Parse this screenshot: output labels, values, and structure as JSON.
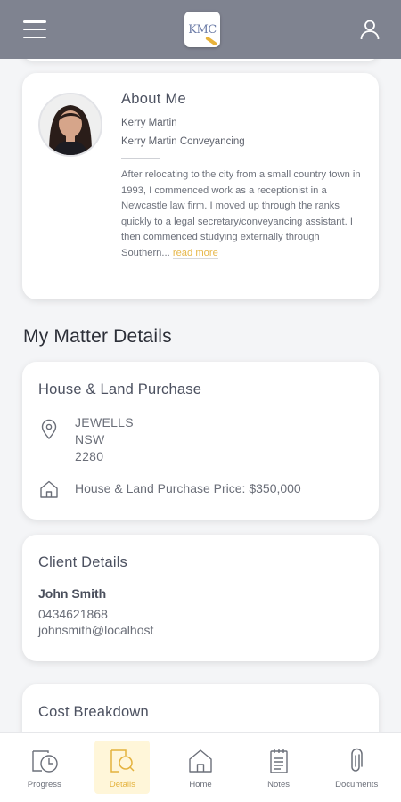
{
  "header": {
    "logo_text": "KMC",
    "menu_icon": "hamburger-menu-icon",
    "user_icon": "user-profile-icon"
  },
  "about": {
    "title": "About Me",
    "name": "Kerry Martin",
    "company": "Kerry Martin Conveyancing",
    "bio": "After relocating to the city from a small country town in 1993, I commenced work as a receptionist in a Newcastle law firm. I moved up through the ranks quickly to a legal secretary/conveyancing assistant. I then commenced studying externally through Southern...",
    "read_more": "read more"
  },
  "section": {
    "title": "My Matter Details"
  },
  "matter": {
    "title": "House & Land Purchase",
    "address": [
      "JEWELLS",
      "NSW",
      "2280"
    ],
    "price_text": "House & Land Purchase Price: $350,000"
  },
  "client": {
    "title": "Client Details",
    "name": "John Smith",
    "phone": "0434621868",
    "email": "johnsmith@localhost"
  },
  "cost": {
    "title": "Cost Breakdown"
  },
  "nav": {
    "items": [
      {
        "label": "Progress",
        "icon": "progress-clock-icon",
        "active": false
      },
      {
        "label": "Details",
        "icon": "details-search-icon",
        "active": true
      },
      {
        "label": "Home",
        "icon": "home-icon",
        "active": false
      },
      {
        "label": "Notes",
        "icon": "notes-icon",
        "active": false
      },
      {
        "label": "Documents",
        "icon": "paperclip-icon",
        "active": false
      }
    ]
  },
  "colors": {
    "header_bg": "#7f8390",
    "accent": "#e4b23d",
    "active_nav_bg": "#fff6d9"
  }
}
